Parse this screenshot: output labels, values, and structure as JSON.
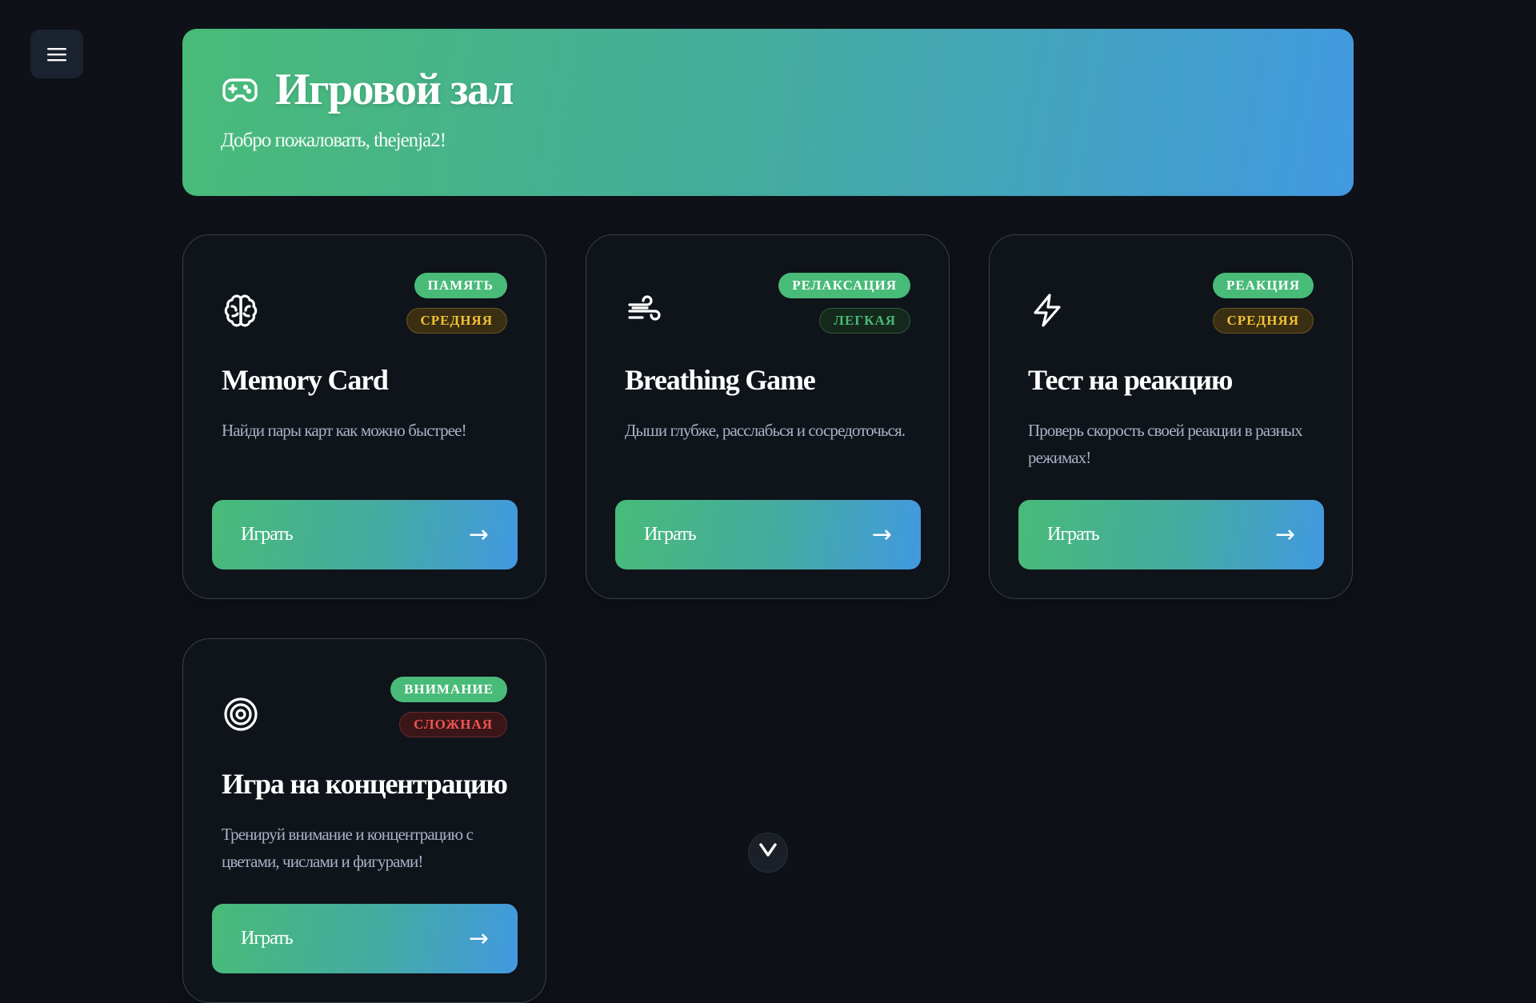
{
  "hero": {
    "title": "Игровой зал",
    "subtitle": "Добро пожаловать, thejenja2!",
    "icon": "gamepad-icon",
    "gradient": [
      "#48bb78",
      "#4299e1"
    ]
  },
  "menu": {
    "icon": "hamburger-menu-icon"
  },
  "games": [
    {
      "icon": "brain-icon",
      "category": "ПАМЯТЬ",
      "difficulty": "СРЕДНЯЯ",
      "title": "Memory Card",
      "description": "Найди пары карт как можно быстрее!",
      "play_label": "Играть",
      "arrow": "→"
    },
    {
      "icon": "wind-icon",
      "category": "РЕЛАКСАЦИЯ",
      "difficulty": "ЛЕГКАЯ",
      "title": "Breathing Game",
      "description": "Дыши глубже, расслабься и сосредоточься.",
      "play_label": "Играть",
      "arrow": "→"
    },
    {
      "icon": "lightning-icon",
      "category": "РЕАКЦИЯ",
      "difficulty": "СРЕДНЯЯ",
      "title": "Тест на реакцию",
      "description": "Проверь скорость своей реакции в разных режимах!",
      "play_label": "Играть",
      "arrow": "→"
    },
    {
      "icon": "target-icon",
      "category": "ВНИМАНИЕ",
      "difficulty": "СЛОЖНАЯ",
      "title": "Игра на концентрацию",
      "description": "Тренируй внимание и концентрацию с цветами, числами и фигурами!",
      "play_label": "Играть",
      "arrow": "→"
    }
  ],
  "colors": {
    "background": "#0e1218",
    "accent_green": "#48bb78",
    "accent_blue": "#4299e1",
    "medium": "#f2c233",
    "easy": "#48bb78",
    "hard": "#f05454"
  }
}
